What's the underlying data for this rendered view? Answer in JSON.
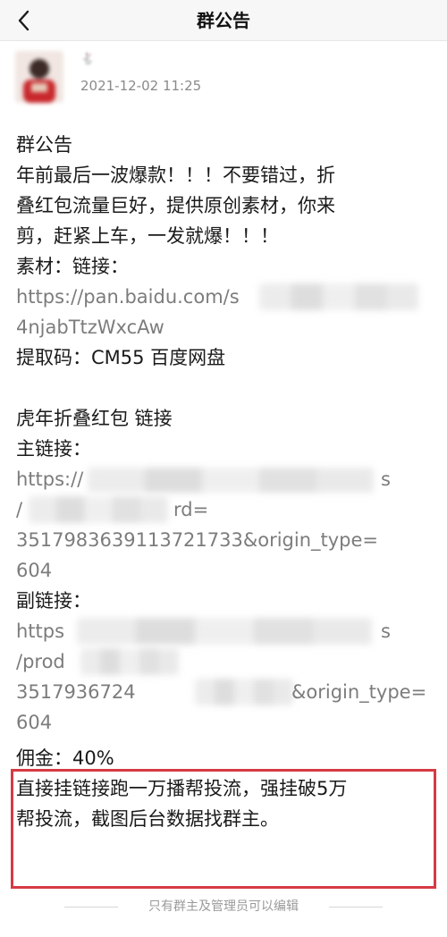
{
  "nav": {
    "title": "群公告",
    "back_icon": "chevron-left-icon"
  },
  "author": {
    "name": "🐇",
    "time": "2021-12-02 11:25"
  },
  "announcement": {
    "heading": "群公告",
    "intro": [
      "年前最后一波爆款！！！不要错过，折",
      "叠红包流量巨好，提供原创素材，你来",
      "剪，赶紧上车，一发就爆！！！"
    ],
    "material_label": "素材：链接：",
    "material_link": [
      "https://pan.baidu.com/s",
      "4njabTtzWxcAw"
    ],
    "extract_code": "提取码：CM55 百度网盘",
    "product_title": "虎年折叠红包 链接",
    "main_link_label": "主链接：",
    "main_link": [
      "https://",
      "/",
      "3517983639113721733&origin_type=",
      "604"
    ],
    "main_link_tail": "s",
    "main_link_fragment": "rd=",
    "sub_link_label": "副链接：",
    "sub_link": [
      "https",
      "/prod",
      "3517936724",
      "604"
    ],
    "sub_link_tail": "s",
    "sub_link_fragment": "&origin_type=",
    "commission": "佣金：40%",
    "commission_detail": [
      "直接挂链接跑一万播帮投流，强挂破5万",
      "帮投流，截图后台数据找群主。"
    ]
  },
  "footer": {
    "note": "只有群主及管理员可以编辑"
  },
  "colors": {
    "highlight": "#d63a45",
    "link_gray": "#7c7c7c"
  }
}
